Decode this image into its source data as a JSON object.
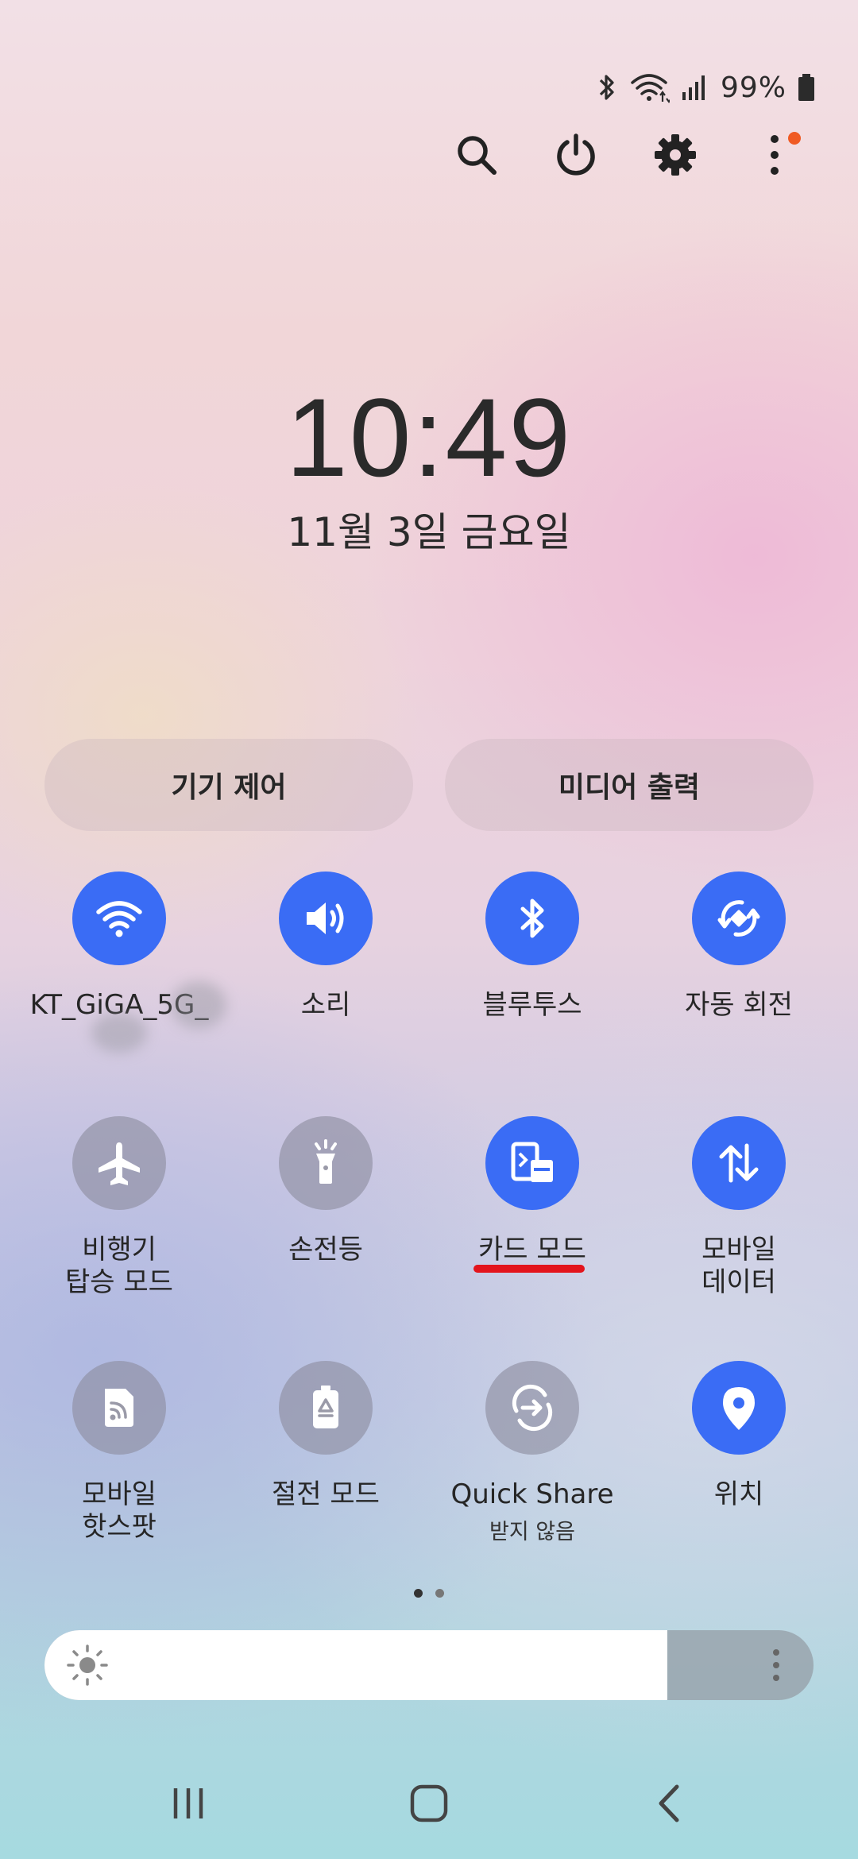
{
  "status": {
    "battery": "99%"
  },
  "header": {
    "icons": [
      "search-icon",
      "power-icon",
      "settings-icon",
      "more-vert-icon"
    ],
    "notification_dot_color": "#f05a23"
  },
  "clock": {
    "time": "10:49",
    "date": "11월 3일 금요일"
  },
  "quick_buttons": {
    "device_control": "기기 제어",
    "media_output": "미디어 출력"
  },
  "tiles": {
    "wifi": {
      "label": "KT_GiGA_5G_",
      "state": "on",
      "icon": "wifi-icon"
    },
    "sound": {
      "label": "소리",
      "state": "on",
      "icon": "volume-icon"
    },
    "bluetooth": {
      "label": "블루투스",
      "state": "on",
      "icon": "bluetooth-icon"
    },
    "auto_rotate": {
      "label": "자동 회전",
      "state": "on",
      "icon": "rotate-icon"
    },
    "airplane": {
      "label": "비행기\n탑승 모드",
      "state": "off",
      "icon": "airplane-icon"
    },
    "flashlight": {
      "label": "손전등",
      "state": "off",
      "icon": "flashlight-icon"
    },
    "card_mode": {
      "label": "카드 모드",
      "state": "on",
      "icon": "card-mode-icon"
    },
    "mobile_data": {
      "label": "모바일\n데이터",
      "state": "on",
      "icon": "data-arrows-icon"
    },
    "hotspot": {
      "label": "모바일\n핫스팟",
      "state": "off",
      "icon": "hotspot-icon"
    },
    "power_saving": {
      "label": "절전 모드",
      "state": "off",
      "icon": "battery-saver-icon"
    },
    "quick_share": {
      "label": "Quick Share",
      "sublabel": "받지 않음",
      "state": "off",
      "icon": "quick-share-icon"
    },
    "location": {
      "label": "위치",
      "state": "on",
      "icon": "location-pin-icon"
    }
  },
  "pages": {
    "current": 1,
    "total": 2
  },
  "brightness": {
    "level": 0.81
  },
  "colors": {
    "tile_on": "#3a6cf5",
    "tile_off": "#8c8c9e",
    "highlight_underline": "#e3141c"
  }
}
